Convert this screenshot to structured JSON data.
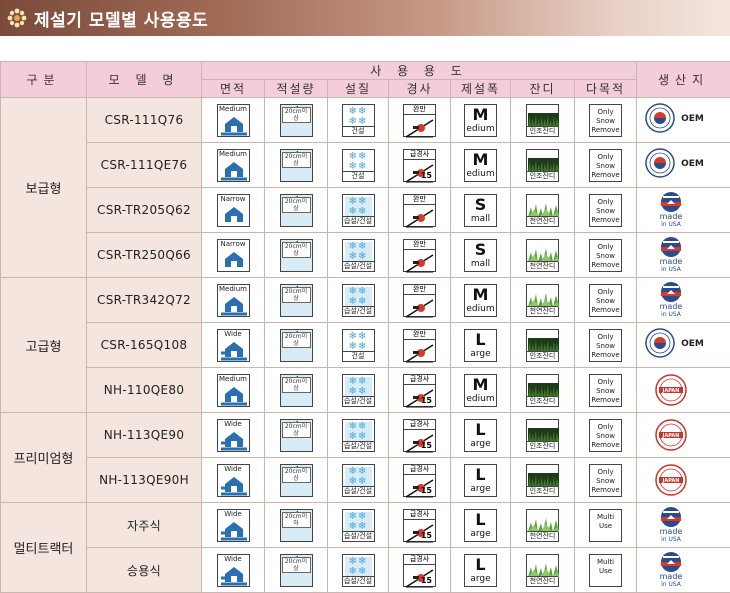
{
  "header": {
    "title": "제설기 모델별 사용용도"
  },
  "columns": {
    "group": "구분",
    "model": "모 델 명",
    "usage": "사 용 용 도",
    "area": "면적",
    "depth": "적설량",
    "quality": "설질",
    "slope": "경사",
    "width": "제설폭",
    "turf": "잔디",
    "multi": "다목적",
    "origin": "생산지"
  },
  "groups": [
    {
      "name": "보급형",
      "rows": 4
    },
    {
      "name": "고급형",
      "rows": 3
    },
    {
      "name": "프리미엄형",
      "rows": 2
    },
    {
      "name": "멀티트랙터",
      "rows": 2
    }
  ],
  "rows": [
    {
      "model": "CSR-111Q76",
      "area": "Medium",
      "depth": "20cm이상",
      "quality": "건설",
      "slope": "완만",
      "width_big": "M",
      "width_small": "edium",
      "turf": "인조잔디",
      "multi": "Only Snow Remove",
      "origin": "OEM"
    },
    {
      "model": "CSR-111QE76",
      "area": "Medium",
      "depth": "20cm이상",
      "quality": "건설",
      "slope": "급경사",
      "slope_num": "15",
      "width_big": "M",
      "width_small": "edium",
      "turf": "인조잔디",
      "multi": "Only Snow Remove",
      "origin": "OEM"
    },
    {
      "model": "CSR-TR205Q62",
      "area": "Narrow",
      "depth": "20cm이상",
      "quality": "습설/건설",
      "slope": "완만",
      "width_big": "S",
      "width_small": "mall",
      "turf": "천연잔디",
      "multi": "Only Snow Remove",
      "origin": "made in USA"
    },
    {
      "model": "CSR-TR250Q66",
      "area": "Narrow",
      "depth": "20cm이상",
      "quality": "습설/건설",
      "slope": "완만",
      "width_big": "S",
      "width_small": "mall",
      "turf": "천연잔디",
      "multi": "Only Snow Remove",
      "origin": "made in USA"
    },
    {
      "model": "CSR-TR342Q72",
      "area": "Medium",
      "depth": "20cm이상",
      "quality": "습설/건설",
      "slope": "완만",
      "width_big": "M",
      "width_small": "edium",
      "turf": "천연잔디",
      "multi": "Only Snow Remove",
      "origin": "made in USA"
    },
    {
      "model": "CSR-165Q108",
      "area": "Wide",
      "depth": "20cm이상",
      "quality": "건설",
      "slope": "완만",
      "width_big": "L",
      "width_small": "arge",
      "turf": "인조잔디",
      "multi": "Only Snow Remove",
      "origin": "OEM"
    },
    {
      "model": "NH-110QE80",
      "area": "Medium",
      "depth": "20cm이상",
      "quality": "습설/건설",
      "slope": "급경사",
      "slope_num": "15",
      "width_big": "M",
      "width_small": "edium",
      "turf": "인조잔디",
      "multi": "Only Snow Remove",
      "origin": "JAPAN"
    },
    {
      "model": "NH-113QE90",
      "area": "Wide",
      "depth": "20cm이상",
      "quality": "습설/건설",
      "slope": "급경사",
      "slope_num": "15",
      "width_big": "L",
      "width_small": "arge",
      "turf": "인조잔디",
      "multi": "Only Snow Remove",
      "origin": "JAPAN"
    },
    {
      "model": "NH-113QE90H",
      "area": "Wide",
      "depth": "20cm이상",
      "quality": "습설/건설",
      "slope": "급경사",
      "slope_num": "15",
      "width_big": "L",
      "width_small": "arge",
      "turf": "인조잔디",
      "multi": "Only Snow Remove",
      "origin": "JAPAN"
    },
    {
      "model": "자주식",
      "area": "Wide",
      "depth": "20cm이하",
      "quality": "습설/건설",
      "slope": "급경사",
      "slope_num": "15",
      "width_big": "L",
      "width_small": "arge",
      "turf": "천연잔디",
      "multi": "Multi Use",
      "origin": "made in USA"
    },
    {
      "model": "승용식",
      "area": "Wide",
      "depth": "20cm이상",
      "quality": "습설/건설",
      "slope": "급경사",
      "slope_num": "15",
      "width_big": "L",
      "width_small": "arge",
      "turf": "천연잔디",
      "multi": "Multi Use",
      "origin": "made in USA"
    }
  ],
  "colors": {
    "header_bar": "#a06a55",
    "col_header": "#f3cdd9",
    "row_bg": "#f4e5de",
    "snow": "#4da7d6",
    "turf_artificial": "#1f3a1a",
    "turf_natural": "#5aa53a"
  }
}
